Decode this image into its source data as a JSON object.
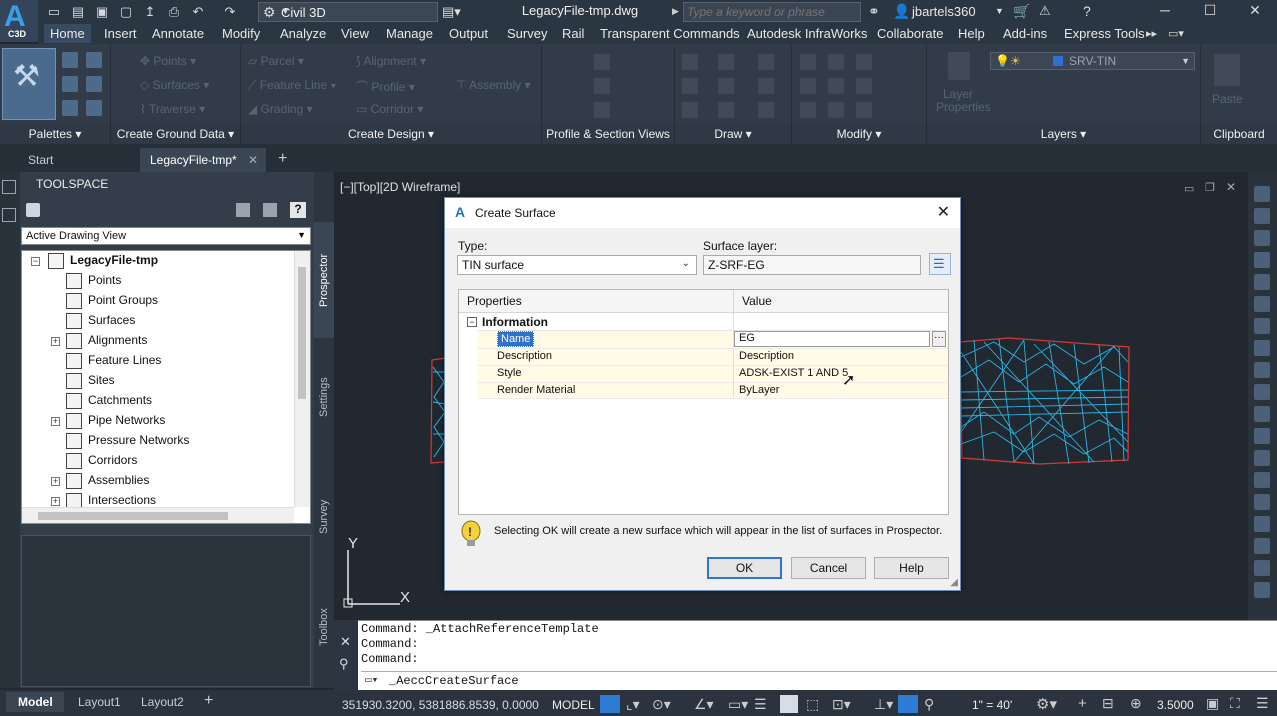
{
  "app": {
    "short_name": "C3D",
    "workspace": "Civil 3D",
    "document_title": "LegacyFile-tmp.dwg",
    "search_placeholder": "Type a keyword or phrase",
    "user": "jbartels360"
  },
  "menu_tabs": [
    "Home",
    "Insert",
    "Annotate",
    "Modify",
    "Analyze",
    "View",
    "Manage",
    "Output",
    "Survey",
    "Rail",
    "Transparent Commands",
    "Autodesk InfraWorks",
    "Collaborate",
    "Help",
    "Add-ins",
    "Express Tools"
  ],
  "active_tab": "Home",
  "ribbon": {
    "panels": [
      "Palettes",
      "Create Ground Data",
      "Create Design",
      "Profile & Section Views",
      "Draw",
      "Modify",
      "Layers",
      "Clipboard"
    ],
    "disabled_items": [
      "Points",
      "Surfaces",
      "Traverse",
      "Parcel",
      "Feature Line",
      "Grading",
      "Alignment",
      "Profile",
      "Corridor",
      "Assembly",
      "Layer Properties",
      "Paste"
    ],
    "layer_name": "SRV-TIN"
  },
  "doc_tabs": {
    "start": "Start",
    "current": "LegacyFile-tmp*"
  },
  "toolspace": {
    "title": "TOOLSPACE",
    "view_select": "Active Drawing View",
    "side_tabs": [
      "Prospector",
      "Settings",
      "Survey",
      "Toolbox"
    ],
    "tree_root": "LegacyFile-tmp",
    "tree_items": [
      "Points",
      "Point Groups",
      "Surfaces",
      "Alignments",
      "Feature Lines",
      "Sites",
      "Catchments",
      "Pipe Networks",
      "Pressure Networks",
      "Corridors",
      "Assemblies",
      "Intersections"
    ]
  },
  "viewport": {
    "label": "[−][Top][2D Wireframe]",
    "axis_x": "X",
    "axis_y": "Y"
  },
  "dialog": {
    "title": "Create Surface",
    "type_label": "Type:",
    "type_value": "TIN surface",
    "layer_label": "Surface layer:",
    "layer_value": "Z-SRF-EG",
    "col_properties": "Properties",
    "col_value": "Value",
    "group": "Information",
    "rows": [
      {
        "prop": "Name",
        "value": "EG"
      },
      {
        "prop": "Description",
        "value": "Description"
      },
      {
        "prop": "Style",
        "value": "ADSK-EXIST 1 AND 5"
      },
      {
        "prop": "Render Material",
        "value": "ByLayer"
      }
    ],
    "info_text": "Selecting OK will create a new surface which will appear in the list of surfaces in Prospector.",
    "ok": "OK",
    "cancel": "Cancel",
    "help": "Help"
  },
  "command": {
    "history": [
      "Command:  _AttachReferenceTemplate",
      "Command:",
      "Command:"
    ],
    "current": "_AeccCreateSurface"
  },
  "status": {
    "layouts": [
      "Model",
      "Layout1",
      "Layout2"
    ],
    "coords": "351930.3200, 5381886.8539, 0.0000",
    "mode": "MODEL",
    "scale": "1\" = 40'",
    "value": "3.5000"
  },
  "colors": {
    "surface_mesh": "#29b6e6",
    "surface_border": "#d23a3a",
    "selection": "#3072c9"
  }
}
